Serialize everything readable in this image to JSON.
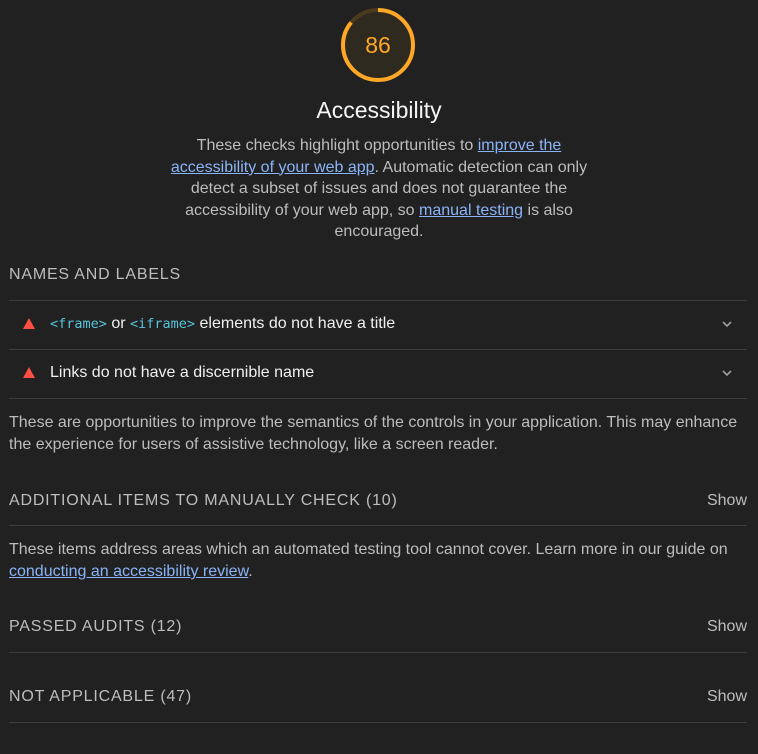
{
  "score": {
    "value": "86",
    "fraction": 0.86,
    "color": "#ffa726"
  },
  "category": {
    "title": "Accessibility",
    "description": {
      "part1": "These checks highlight opportunities to ",
      "link1": "improve the accessibility of your web app",
      "part2": ". Automatic detection can only detect a subset of issues and does not guarantee the accessibility of your web app, so ",
      "link2": "manual testing",
      "part3": " is also encouraged."
    }
  },
  "groups": {
    "names_labels": {
      "title": "NAMES AND LABELS",
      "audits": [
        {
          "code1": "<frame>",
          "mid": " or ",
          "code2": "<iframe>",
          "text": " elements do not have a title",
          "icon": "fail-triangle-icon"
        },
        {
          "text": "Links do not have a discernible name",
          "icon": "fail-triangle-icon"
        }
      ],
      "description": "These are opportunities to improve the semantics of the controls in your application. This may enhance the experience for users of assistive technology, like a screen reader."
    },
    "manual": {
      "title": "ADDITIONAL ITEMS TO MANUALLY CHECK (10)",
      "show": "Show",
      "description": "These items address areas which an automated testing tool cannot cover. Learn more in our guide on ",
      "link": "conducting an accessibility review",
      "description_end": "."
    },
    "passed": {
      "title": "PASSED AUDITS (12)",
      "show": "Show"
    },
    "not_applicable": {
      "title": "NOT APPLICABLE (47)",
      "show": "Show"
    }
  },
  "colors": {
    "background": "#212121",
    "fail": "#ff4e42",
    "average": "#ffa726",
    "link": "#8ab4f8",
    "code": "#58c4dc"
  }
}
